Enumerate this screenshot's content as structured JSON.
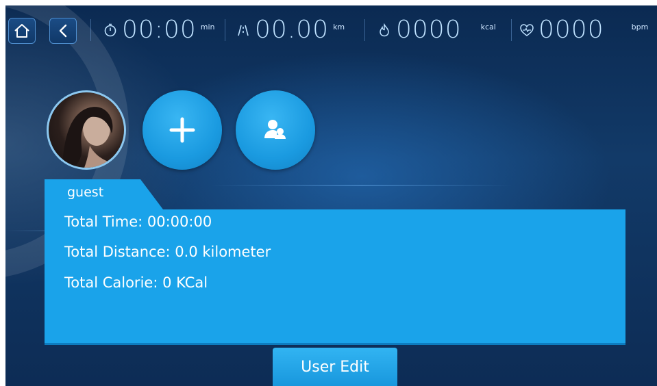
{
  "topbar": {
    "time": {
      "value": "00:00",
      "unit": "min",
      "icon": "stopwatch-icon"
    },
    "distance": {
      "value": "00.00",
      "unit": "km",
      "icon": "road-icon"
    },
    "calories": {
      "value": "0000",
      "unit": "kcal",
      "icon": "flame-icon"
    },
    "heart_rate": {
      "value": "0000",
      "unit": "bpm",
      "icon": "heart-pulse-icon"
    }
  },
  "users": {
    "add_icon": "plus-icon",
    "manage_icon": "user-group-icon"
  },
  "card": {
    "user_name": "guest",
    "total_time": "Total Time:  00:00:00",
    "total_distance": "Total Distance:  0.0 kilometer",
    "total_calorie": "Total Calorie:  0 KCal"
  },
  "actions": {
    "user_edit_label": "User Edit"
  },
  "colors": {
    "accent": "#1aa3ea",
    "background": "#123a68",
    "stat_text": "#bfe2ff"
  }
}
